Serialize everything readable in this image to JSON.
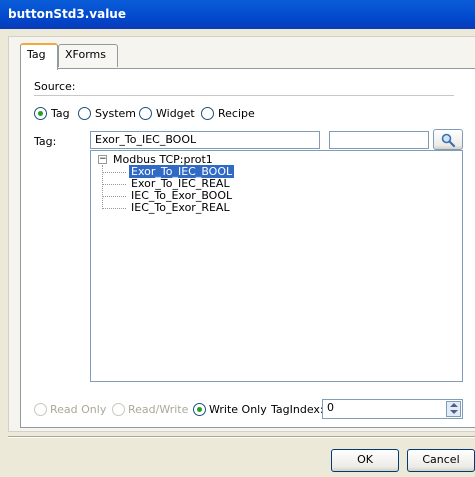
{
  "window": {
    "title": "buttonStd3.value"
  },
  "tabs": [
    {
      "label": "Tag"
    },
    {
      "label": "XForms"
    }
  ],
  "source": {
    "label": "Source:",
    "options": [
      {
        "label": "Tag",
        "selected": true
      },
      {
        "label": "System"
      },
      {
        "label": "Widget"
      },
      {
        "label": "Recipe"
      }
    ]
  },
  "tag": {
    "label": "Tag:",
    "value": "Exor_To_IEC_BOOL",
    "search_value": ""
  },
  "tree": {
    "root": "Modbus TCP:prot1",
    "items": [
      "Exor_To_IEC_BOOL",
      "Exor_To_IEC_REAL",
      "IEC_To_Exor_BOOL",
      "IEC_To_Exor_REAL"
    ],
    "selected_index": 0
  },
  "access": {
    "options": [
      {
        "label": "Read Only",
        "enabled": false
      },
      {
        "label": "Read/Write",
        "enabled": false
      },
      {
        "label": "Write Only",
        "enabled": true,
        "selected": true
      }
    ],
    "tagindex_label": "TagIndex:",
    "tagindex_value": "0"
  },
  "buttons": {
    "ok": "OK",
    "cancel": "Cancel"
  },
  "colors": {
    "title_bar": "#0a5bd6",
    "selection": "#316ac5",
    "tab_accent": "#f3a93a"
  }
}
